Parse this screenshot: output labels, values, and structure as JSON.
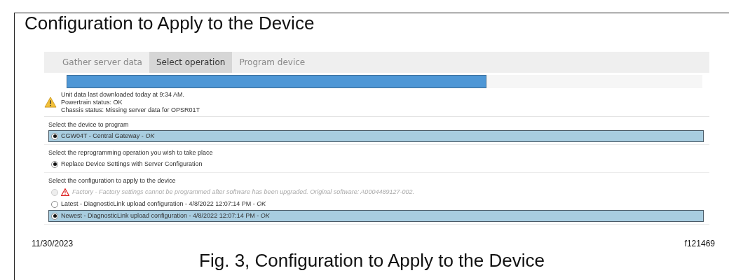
{
  "title": "Configuration to Apply to the Device",
  "tabs": [
    {
      "label": "Gather server data",
      "selected": false
    },
    {
      "label": "Select operation",
      "selected": true
    },
    {
      "label": "Program device",
      "selected": false
    }
  ],
  "progress": {
    "level": 0.66
  },
  "status": {
    "lines": [
      "Unit data last downloaded today at 9:34 AM.",
      "Powertrain status: OK",
      "Chassis status: Missing server data for OPSR01T"
    ]
  },
  "sections": [
    {
      "prompt": "Select the device to program",
      "options": [
        {
          "label": "CGW04T - Central Gateway - *OK*",
          "selected": true,
          "highlighted": true,
          "disabled": false,
          "warning": false
        }
      ]
    },
    {
      "prompt": "Select the reprogramming operation you wish to take place",
      "options": [
        {
          "label": "Replace Device Settings with Server Configuration",
          "selected": true,
          "highlighted": false,
          "disabled": false,
          "warning": false
        }
      ]
    },
    {
      "prompt": "Select the configuration to apply to the device",
      "options": [
        {
          "label": "Factory - Factory settings cannot be programmed after software has been upgraded. Original software: A0004489127-002.",
          "selected": false,
          "highlighted": false,
          "disabled": true,
          "warning": true
        },
        {
          "label": "Latest - DiagnosticLink upload configuration - 4/8/2022 12:07:14 PM - *OK*",
          "selected": false,
          "highlighted": false,
          "disabled": false,
          "warning": false
        },
        {
          "label": "Newest - DiagnosticLink upload configuration - 4/8/2022 12:07:14 PM - *OK*",
          "selected": true,
          "highlighted": true,
          "disabled": false,
          "warning": false
        }
      ]
    }
  ],
  "footer": {
    "date": "11/30/2023",
    "figure_id": "f121469",
    "caption": "Fig. 3, Configuration to Apply to the Device"
  }
}
